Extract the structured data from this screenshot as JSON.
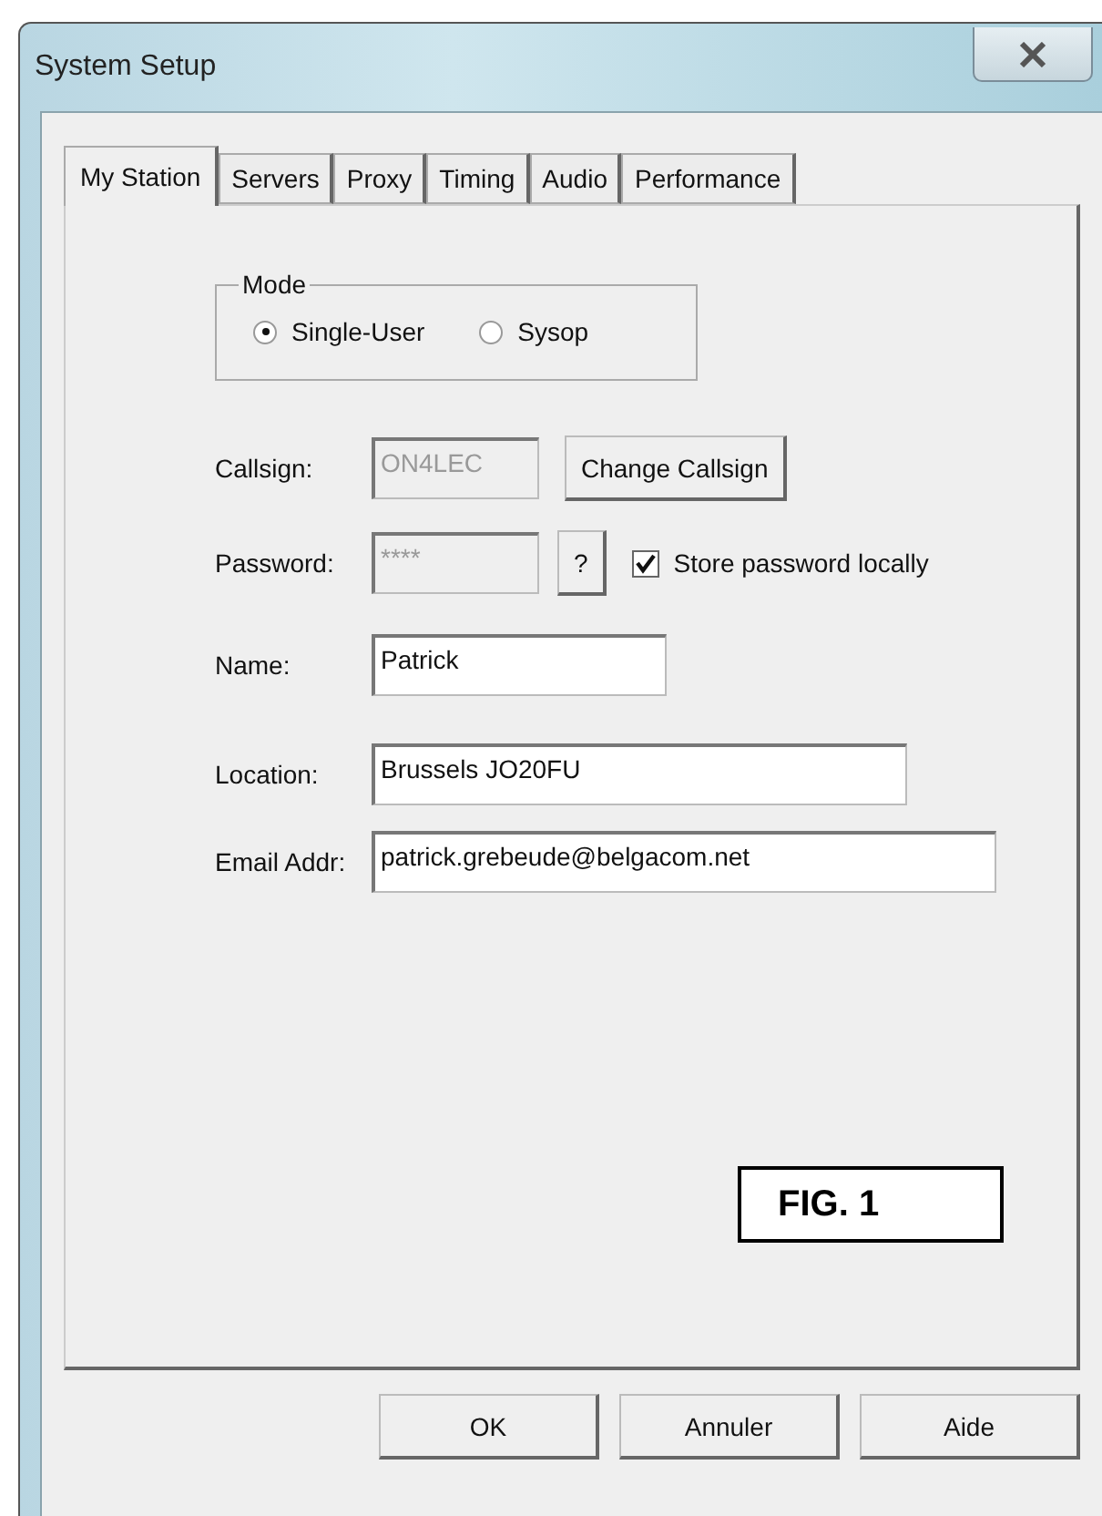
{
  "window": {
    "title": "System Setup"
  },
  "tabs": [
    {
      "label": "My Station",
      "selected": true
    },
    {
      "label": "Servers",
      "selected": false
    },
    {
      "label": "Proxy",
      "selected": false
    },
    {
      "label": "Timing",
      "selected": false
    },
    {
      "label": "Audio",
      "selected": false
    },
    {
      "label": "Performance",
      "selected": false
    }
  ],
  "mode": {
    "title": "Mode",
    "options": [
      {
        "label": "Single-User",
        "selected": true
      },
      {
        "label": "Sysop",
        "selected": false
      }
    ]
  },
  "callsign": {
    "label": "Callsign:",
    "value": "ON4LEC",
    "disabled": true,
    "button": "Change Callsign"
  },
  "password": {
    "label": "Password:",
    "value": "****",
    "disabled": true,
    "help": "?",
    "store": {
      "label": "Store password locally",
      "checked": true
    }
  },
  "fields": [
    {
      "label": "Name:",
      "value": "Patrick"
    },
    {
      "label": "Location:",
      "value": "Brussels JO20FU"
    },
    {
      "label": "Email Addr:",
      "value": "patrick.grebeude@belgacom.net"
    }
  ],
  "figure_label": "FIG. 1",
  "buttons": [
    "OK",
    "Annuler",
    "Aide"
  ]
}
